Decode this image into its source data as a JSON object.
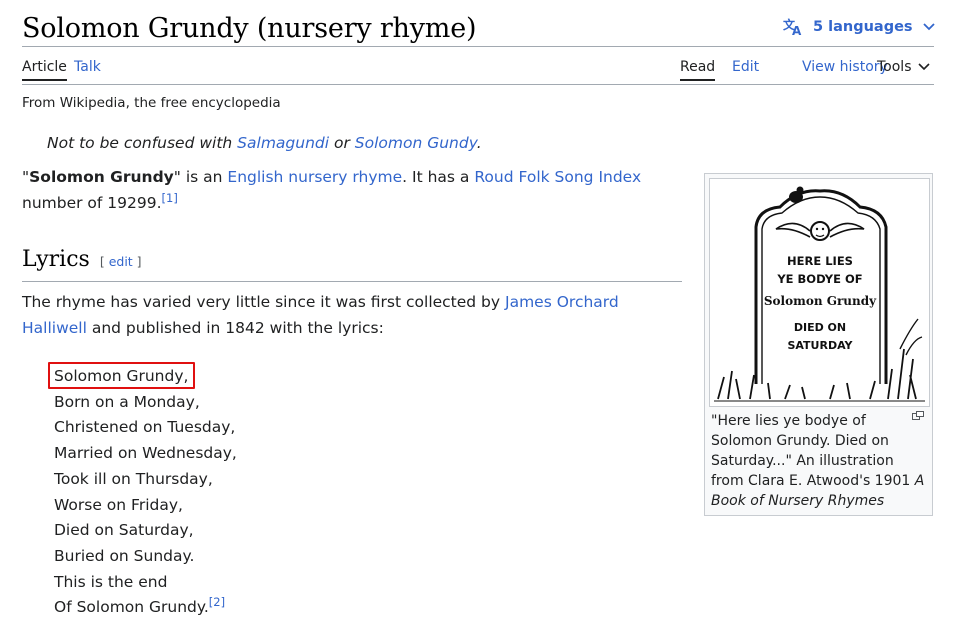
{
  "page": {
    "title": "Solomon Grundy (nursery rhyme)",
    "languages_label": "5 languages",
    "tagline": "From Wikipedia, the free encyclopedia"
  },
  "tabs": {
    "article": "Article",
    "talk": "Talk",
    "read": "Read",
    "edit": "Edit",
    "history": "View history",
    "tools": "Tools"
  },
  "hatnote": {
    "prefix": "Not to be confused with ",
    "link1": "Salmagundi",
    "middle": " or ",
    "link2": "Solomon Gundy",
    "suffix": "."
  },
  "intro": {
    "quote_open": "\"",
    "bold": "Solomon Grundy",
    "part1": "\" is an ",
    "link1": "English nursery rhyme",
    "part2": ". It has a ",
    "link2": "Roud Folk Song Index",
    "part3": " number of 19299.",
    "ref": "[1]"
  },
  "lyrics": {
    "heading": "Lyrics",
    "edit_open": "[ ",
    "edit_label": "edit",
    "edit_close": " ]",
    "para_part1": "The rhyme has varied very little since it was first collected by ",
    "para_link": "James Orchard Halliwell",
    "para_part2": " and published in 1842 with the lyrics:",
    "lines": [
      "Solomon Grundy,",
      "Born on a Monday,",
      "Christened on Tuesday,",
      "Married on Wednesday,",
      "Took ill on Thursday,",
      "Worse on Friday,",
      "Died on Saturday,",
      "Buried on Sunday.",
      "This is the end",
      "Of Solomon Grundy."
    ],
    "last_ref": "[2]"
  },
  "infobox": {
    "image_inscription": [
      "HERE LIES",
      "YE BODYE OF",
      "Solomon Grundy",
      "DIED ON",
      "SATURDAY"
    ],
    "caption_plain": "\"Here lies ye bodye of Solomon Grundy. Died on Saturday...\" An illustration from Clara E. Atwood's 1901 ",
    "caption_italic": "A Book of Nursery Rhymes"
  },
  "colors": {
    "link": "#3366cc",
    "text": "#202122",
    "highlight_box": "#e01010",
    "rule": "#a2a9b1"
  },
  "icons": [
    "translate-icon",
    "chevron-down-icon",
    "enlarge-icon"
  ]
}
